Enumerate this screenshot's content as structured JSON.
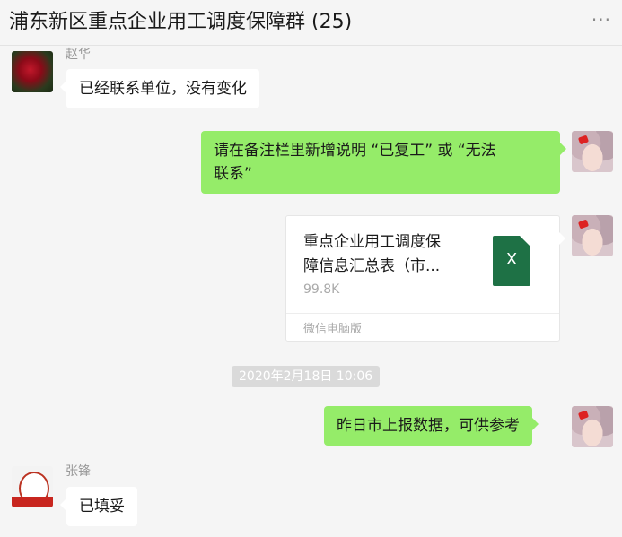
{
  "header": {
    "title": "浦东新区重点企业用工调度保障群 (25)",
    "more_label": "···"
  },
  "messages": [
    {
      "side": "left",
      "sender": "赵华",
      "avatar": "rose-avatar",
      "text": "已经联系单位，没有变化"
    },
    {
      "side": "right",
      "avatar": "anime-avatar",
      "text_line1": "请在备注栏里新增说明 “已复工” 或 “无法",
      "text_line2": "联系”"
    },
    {
      "side": "right",
      "type": "file",
      "avatar": "anime-avatar",
      "file_name_line1": "重点企业用工调度保",
      "file_name_line2": "障信息汇总表（市...",
      "file_size": "99.8K",
      "file_icon_letter": "X",
      "source": "微信电脑版"
    },
    {
      "type": "time",
      "text": "2020年2月18日 10:06"
    },
    {
      "side": "right",
      "avatar": "anime-avatar",
      "text": "昨日市上报数据，可供参考"
    },
    {
      "side": "left",
      "sender": "张锋",
      "avatar": "face-avatar",
      "text": "已填妥"
    }
  ]
}
